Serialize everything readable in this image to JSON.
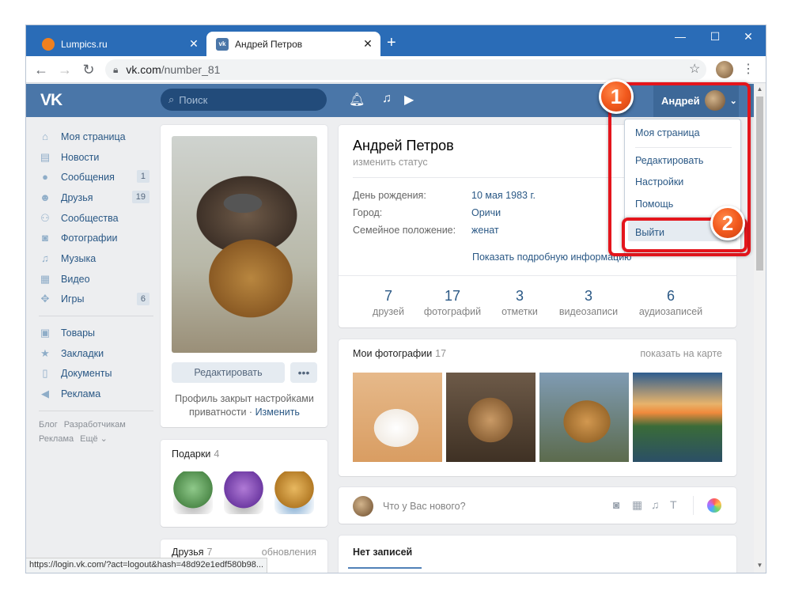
{
  "browser": {
    "tabs": [
      {
        "title": "Lumpics.ru",
        "close": "✕"
      },
      {
        "title": "Андрей Петров",
        "close": "✕"
      }
    ],
    "new_tab": "+",
    "window_controls": {
      "minimize": "—",
      "maximize": "☐",
      "close": "✕"
    },
    "url_host": "vk.com",
    "url_path": "/number_81",
    "status_url": "https://login.vk.com/?act=logout&hash=48d92e1edf580b98..."
  },
  "vk": {
    "logo": "VK",
    "search_placeholder": "Поиск",
    "user_name": "Андрей",
    "nav": [
      {
        "label": "Моя страница",
        "icon": "home-icon",
        "count": ""
      },
      {
        "label": "Новости",
        "icon": "news-icon",
        "count": ""
      },
      {
        "label": "Сообщения",
        "icon": "messages-icon",
        "count": "1"
      },
      {
        "label": "Друзья",
        "icon": "friends-icon",
        "count": "19"
      },
      {
        "label": "Сообщества",
        "icon": "communities-icon",
        "count": ""
      },
      {
        "label": "Фотографии",
        "icon": "camera-icon",
        "count": ""
      },
      {
        "label": "Музыка",
        "icon": "music-icon",
        "count": ""
      },
      {
        "label": "Видео",
        "icon": "video-icon",
        "count": ""
      },
      {
        "label": "Игры",
        "icon": "games-icon",
        "count": "6"
      }
    ],
    "nav2": [
      {
        "label": "Товары",
        "icon": "shop-icon"
      },
      {
        "label": "Закладки",
        "icon": "star-icon"
      },
      {
        "label": "Документы",
        "icon": "document-icon"
      },
      {
        "label": "Реклама",
        "icon": "ads-icon"
      }
    ],
    "footer": {
      "blog": "Блог",
      "dev": "Разработчикам",
      "ads": "Реклама",
      "more": "Ещё ⌄"
    },
    "profile_card": {
      "edit": "Редактировать",
      "more": "•••",
      "privacy_text": "Профиль закрыт настройками приватности · ",
      "privacy_link": "Изменить"
    },
    "gifts": {
      "title": "Подарки",
      "count": "4"
    },
    "friends": {
      "title": "Друзья",
      "count": "7",
      "updates": "обновления"
    },
    "profile": {
      "name": "Андрей Петров",
      "status": "изменить статус",
      "rows": [
        {
          "label": "День рождения:",
          "value": "10 мая 1983 г."
        },
        {
          "label": "Город:",
          "value": "Оричи"
        },
        {
          "label": "Семейное положение:",
          "value": "женат"
        }
      ],
      "show_more": "Показать подробную информацию",
      "stats": [
        {
          "num": "7",
          "label": "друзей"
        },
        {
          "num": "17",
          "label": "фотографий"
        },
        {
          "num": "3",
          "label": "отметки"
        },
        {
          "num": "3",
          "label": "видеозаписи"
        },
        {
          "num": "6",
          "label": "аудиозаписей"
        }
      ]
    },
    "photos": {
      "title": "Мои фотографии",
      "count": "17",
      "map": "показать на карте"
    },
    "post": {
      "placeholder": "Что у Вас нового?"
    },
    "wall": {
      "tab": "Нет записей"
    },
    "dropdown": [
      "Моя страница",
      "Редактировать",
      "Настройки",
      "Помощь",
      "Выйти"
    ]
  },
  "annotations": {
    "badge1": "1",
    "badge2": "2"
  },
  "colors": {
    "vk_blue": "#4a76a8",
    "chrome_blue": "#2a6cb7",
    "highlight_red": "#e4151c",
    "badge_orange": "#f2591d"
  }
}
